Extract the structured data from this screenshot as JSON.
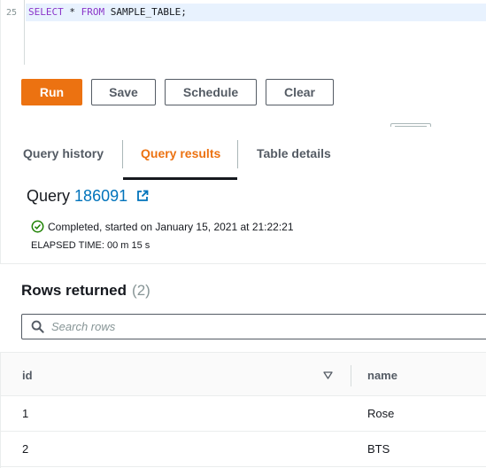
{
  "editor": {
    "line_number": "25",
    "code_tokens": [
      {
        "text": "SELECT",
        "kind": "keyword"
      },
      {
        "text": " * ",
        "kind": "plain"
      },
      {
        "text": "FROM",
        "kind": "keyword"
      },
      {
        "text": " SAMPLE_TABLE;",
        "kind": "plain"
      }
    ]
  },
  "toolbar": {
    "run_label": "Run",
    "save_label": "Save",
    "schedule_label": "Schedule",
    "clear_label": "Clear"
  },
  "tabs": [
    {
      "label": "Query history",
      "active": false
    },
    {
      "label": "Query results",
      "active": true
    },
    {
      "label": "Table details",
      "active": false
    }
  ],
  "query": {
    "title_prefix": "Query",
    "id": "186091",
    "status_text": "Completed, started on January 15, 2021 at 21:22:21",
    "elapsed_text": "ELAPSED TIME: 00 m 15 s"
  },
  "results": {
    "heading": "Rows returned",
    "count": "(2)",
    "search_placeholder": "Search rows",
    "search_value": "",
    "columns": [
      "id",
      "name"
    ],
    "rows": [
      [
        "1",
        "Rose"
      ],
      [
        "2",
        "BTS"
      ]
    ]
  },
  "icons": {
    "external_link": "external-link-icon",
    "status": "check-circle-icon",
    "search": "search-icon",
    "sort": "sort-down-icon"
  },
  "colors": {
    "accent": "#ec7211",
    "link": "#0073bb",
    "success": "#1d8102",
    "text": "#16191f",
    "muted": "#879596"
  }
}
